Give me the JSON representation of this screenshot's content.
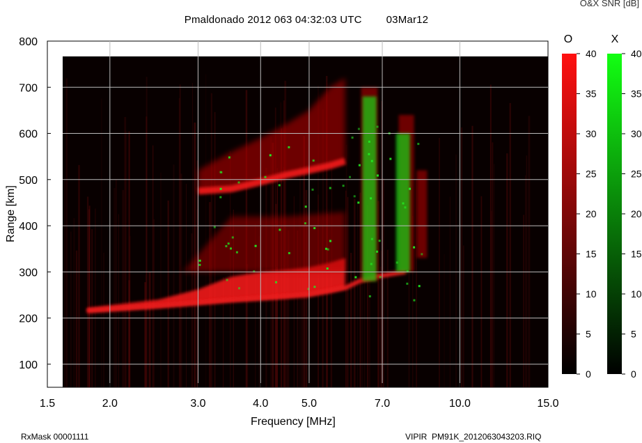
{
  "header": {
    "title": "Pmaldonado 2012 063 04:32:03 UTC        03Mar12",
    "corner_label": "O&X SNR [dB]"
  },
  "footer": {
    "left": "RxMask 00001111",
    "right": "VIPIR  PM91K_2012063043203.RIQ"
  },
  "chart_data": {
    "type": "heatmap",
    "title": "Pmaldonado 2012 063 04:32:03 UTC        03Mar12",
    "xlabel": "Frequency [MHz]",
    "ylabel": "Range [km]",
    "x_scale": "log",
    "xlim": [
      1.5,
      15.0
    ],
    "ylim": [
      50,
      800
    ],
    "x_ticks": [
      1.5,
      2.0,
      3.0,
      4.0,
      5.0,
      7.0,
      10.0,
      15.0
    ],
    "x_tick_labels": [
      "1.5",
      "2.0",
      "3.0",
      "4.0",
      "5.0",
      "7.0",
      "10.0",
      "15.0"
    ],
    "y_ticks": [
      100,
      200,
      300,
      400,
      500,
      600,
      700,
      800
    ],
    "y_tick_labels": [
      "100",
      "200",
      "300",
      "400",
      "500",
      "600",
      "700",
      "800"
    ],
    "grid": true,
    "colorbars": [
      {
        "name": "O",
        "color": "#ff0000",
        "range": [
          0,
          40
        ],
        "ticks": [
          "0",
          "5",
          "10",
          "15",
          "20",
          "25",
          "30",
          "35",
          "40"
        ]
      },
      {
        "name": "X",
        "color": "#00ff00",
        "range": [
          0,
          40
        ],
        "ticks": [
          "0",
          "5",
          "10",
          "15",
          "20",
          "25",
          "30",
          "35",
          "40"
        ]
      }
    ],
    "o_trace": [
      [
        1.8,
        215
      ],
      [
        2.5,
        225
      ],
      [
        3.0,
        232
      ],
      [
        3.5,
        238
      ],
      [
        4.0,
        242
      ],
      [
        4.5,
        246
      ],
      [
        5.0,
        250
      ],
      [
        5.5,
        258
      ],
      [
        5.9,
        265
      ],
      [
        6.3,
        280
      ],
      [
        6.8,
        290
      ],
      [
        7.8,
        300
      ]
    ],
    "o_trace_upper": [
      [
        3.0,
        475
      ],
      [
        3.5,
        480
      ],
      [
        4.0,
        495
      ],
      [
        4.5,
        510
      ],
      [
        5.0,
        520
      ],
      [
        5.5,
        530
      ],
      [
        5.9,
        540
      ]
    ],
    "x_trace_columns": [
      [
        6.6,
        280,
        680
      ],
      [
        7.7,
        300,
        600
      ]
    ]
  }
}
